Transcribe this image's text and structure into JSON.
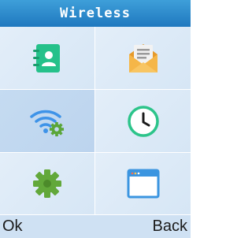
{
  "header": {
    "title": "Wireless"
  },
  "menu": {
    "items": [
      {
        "icon": "contacts-icon",
        "selected": false
      },
      {
        "icon": "message-icon",
        "selected": false
      },
      {
        "icon": "wifi-settings-icon",
        "selected": true
      },
      {
        "icon": "clock-icon",
        "selected": false
      },
      {
        "icon": "gear-icon",
        "selected": false
      },
      {
        "icon": "browser-window-icon",
        "selected": false
      }
    ]
  },
  "softkeys": {
    "left": "Ok",
    "right": "Back"
  },
  "colors": {
    "title_bar": "#2b8bd0",
    "selected_cell": "#c2d8f0",
    "cell_bg": "#dde9f7",
    "green": "#2cc48a",
    "orange": "#f2a93b",
    "wifi_blue": "#3e93e8",
    "gear_green": "#62a83a"
  }
}
